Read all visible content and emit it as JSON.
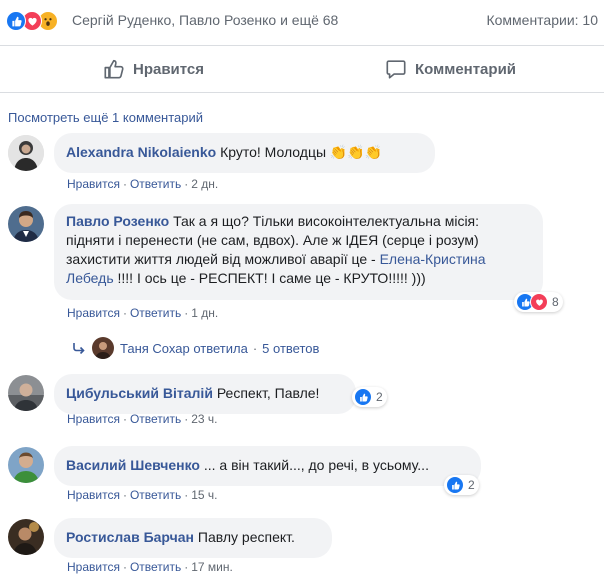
{
  "summary": {
    "reactors_text": "Сергій Руденко, Павло Розенко и ещё 68",
    "comments_text": "Комментарии: 10"
  },
  "actions": {
    "like_label": "Нравится",
    "comment_label": "Комментарий"
  },
  "more_comments": "Посмотреть ещё 1 комментарий",
  "colors": {
    "accent": "#385898",
    "like": "#1877f2",
    "love": "#f33e58",
    "bubble": "#f2f3f5"
  },
  "comments": [
    {
      "author": "Alexandra Nikolaienko",
      "text": "Круто! Молодцы",
      "emoji": "👏👏👏",
      "like_action": "Нравится",
      "reply_action": "Ответить",
      "time": "2 дн."
    },
    {
      "author": "Павло Розенко",
      "text_before": "Так а я що? Тільки високоінтелектуальна місія: підняти і перенести (не сам, вдвох). Але ж ІДЕЯ (серце і розум) захистити життя людей від можливої аварії це - ",
      "mention": "Елена-Кристина Лебедь",
      "text_after": " !!!! І ось це - РЕСПЕКТ! І саме це - КРУТО!!!!! )))",
      "reactions_count": "8",
      "like_action": "Нравится",
      "reply_action": "Ответить",
      "time": "1 дн.",
      "reply_summary": {
        "name": "Таня Сохар ответила",
        "count": "5 ответов"
      }
    },
    {
      "author": "Цибульський Віталій",
      "text": "Респект, Павле!",
      "reactions_count": "2",
      "like_action": "Нравится",
      "reply_action": "Ответить",
      "time": "23 ч."
    },
    {
      "author": "Василий Шевченко",
      "text": "... а він такий..., до речі, в усьому...",
      "reactions_count": "2",
      "like_action": "Нравится",
      "reply_action": "Ответить",
      "time": "15 ч."
    },
    {
      "author": "Ростислав Барчан",
      "text": "Павлу респект.",
      "like_action": "Нравится",
      "reply_action": "Ответить",
      "time": "17 мин."
    }
  ]
}
